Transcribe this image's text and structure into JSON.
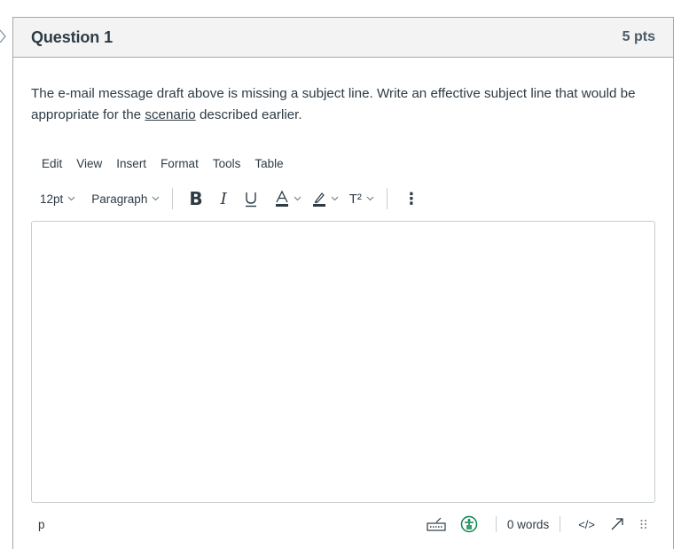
{
  "question": {
    "title": "Question 1",
    "points": "5 pts",
    "text_before_link": "The e-mail message draft above is missing a subject line.  Write an effective subject line that would be appropriate for the ",
    "link_text": "scenario",
    "text_after_link": " described earlier."
  },
  "editor": {
    "menubar": [
      "Edit",
      "View",
      "Insert",
      "Format",
      "Tools",
      "Table"
    ],
    "toolbar": {
      "font_size": "12pt",
      "block_format": "Paragraph",
      "bold_label": "B",
      "italic_label": "I",
      "superscript_label": "T²",
      "more_label": "⋮"
    },
    "content": "",
    "statusbar": {
      "path": "p",
      "word_count": "0 words",
      "html_toggle_label": "</>"
    },
    "colors": {
      "text_color_bar": "#2d3b45",
      "highlight_bar": "#2d3b45",
      "accessibility_icon": "#0b874b",
      "keyboard_icon": "#2d3b45"
    }
  }
}
